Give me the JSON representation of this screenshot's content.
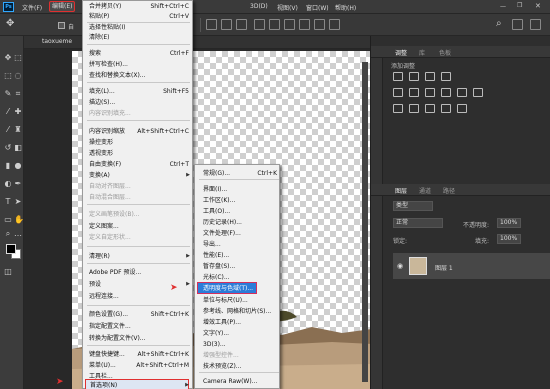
{
  "menubar": {
    "logo": "Ps",
    "items": [
      "文件(F)",
      "编辑(E)",
      "3D(D)",
      "视图(V)",
      "窗口(W)",
      "帮助(H)"
    ]
  },
  "options": {
    "auto_select": "自"
  },
  "document": {
    "tab": "taoxueme"
  },
  "edit_menu": {
    "items": [
      {
        "label": "合并拷贝(Y)",
        "shortcut": "Shift+Ctrl+C"
      },
      {
        "label": "粘贴(P)",
        "shortcut": "Ctrl+V"
      },
      {
        "label": "选择性粘贴(I)",
        "shortcut": ""
      },
      {
        "label": "清除(E)",
        "shortcut": ""
      },
      {
        "label": "搜索",
        "shortcut": "Ctrl+F"
      },
      {
        "label": "拼写检查(H)...",
        "shortcut": ""
      },
      {
        "label": "查找和替换文本(X)...",
        "shortcut": ""
      },
      {
        "label": "填充(L)...",
        "shortcut": "Shift+F5"
      },
      {
        "label": "描边(S)...",
        "shortcut": ""
      },
      {
        "label": "内容识别填充...",
        "shortcut": ""
      },
      {
        "label": "内容识别缩放",
        "shortcut": "Alt+Shift+Ctrl+C"
      },
      {
        "label": "操控变形",
        "shortcut": ""
      },
      {
        "label": "透视变形",
        "shortcut": ""
      },
      {
        "label": "自由变换(F)",
        "shortcut": "Ctrl+T"
      },
      {
        "label": "变换(A)",
        "shortcut": ""
      },
      {
        "label": "自动对齐图层...",
        "shortcut": ""
      },
      {
        "label": "自动混合图层...",
        "shortcut": ""
      },
      {
        "label": "定义画笔预设(B)...",
        "shortcut": ""
      },
      {
        "label": "定义图案...",
        "shortcut": ""
      },
      {
        "label": "定义自定形状...",
        "shortcut": ""
      },
      {
        "label": "清理(R)",
        "shortcut": ""
      },
      {
        "label": "Adobe PDF 预设...",
        "shortcut": ""
      },
      {
        "label": "预设",
        "shortcut": ""
      },
      {
        "label": "远程连接...",
        "shortcut": ""
      },
      {
        "label": "颜色设置(G)...",
        "shortcut": "Shift+Ctrl+K"
      },
      {
        "label": "指定配置文件...",
        "shortcut": ""
      },
      {
        "label": "转换为配置文件(V)...",
        "shortcut": ""
      },
      {
        "label": "键盘快捷键...",
        "shortcut": "Alt+Shift+Ctrl+K"
      },
      {
        "label": "菜单(U)...",
        "shortcut": "Alt+Shift+Ctrl+M"
      },
      {
        "label": "工具栏...",
        "shortcut": ""
      },
      {
        "label": "首选项(N)",
        "shortcut": ""
      }
    ]
  },
  "prefs_submenu": {
    "items": [
      {
        "label": "常规(G)...",
        "shortcut": "Ctrl+K"
      },
      {
        "label": "界面(I)...",
        "shortcut": ""
      },
      {
        "label": "工作区(K)...",
        "shortcut": ""
      },
      {
        "label": "工具(O)...",
        "shortcut": ""
      },
      {
        "label": "历史记录(H)...",
        "shortcut": ""
      },
      {
        "label": "文件处理(F)...",
        "shortcut": ""
      },
      {
        "label": "导出...",
        "shortcut": ""
      },
      {
        "label": "性能(E)...",
        "shortcut": ""
      },
      {
        "label": "暂存盘(S)...",
        "shortcut": ""
      },
      {
        "label": "光标(C)...",
        "shortcut": ""
      },
      {
        "label": "透明度与色域(T)...",
        "shortcut": ""
      },
      {
        "label": "单位与标尺(U)...",
        "shortcut": ""
      },
      {
        "label": "参考线、网格和切片(S)...",
        "shortcut": ""
      },
      {
        "label": "增效工具(P)...",
        "shortcut": ""
      },
      {
        "label": "文字(Y)...",
        "shortcut": ""
      },
      {
        "label": "3D(3)...",
        "shortcut": ""
      },
      {
        "label": "增强型控件...",
        "shortcut": ""
      },
      {
        "label": "技术预览(Z)...",
        "shortcut": ""
      },
      {
        "label": "Camera Raw(W)...",
        "shortcut": ""
      }
    ]
  },
  "right_panel": {
    "adj_tabs": [
      "调整",
      "库",
      "色板"
    ],
    "adj_label": "添加调整",
    "layer_tabs": [
      "图层",
      "通道",
      "路径"
    ],
    "kind": "类型",
    "blend": "正常",
    "opacity_label": "不透明度:",
    "opacity": "100%",
    "lock_label": "锁定:",
    "fill_label": "填充:",
    "fill": "100%",
    "layer_name": "图层 1"
  },
  "colors": {
    "menu_bg": "#f0f0f0",
    "highlight": "#2c7cd8",
    "annotation": "#e03030"
  }
}
